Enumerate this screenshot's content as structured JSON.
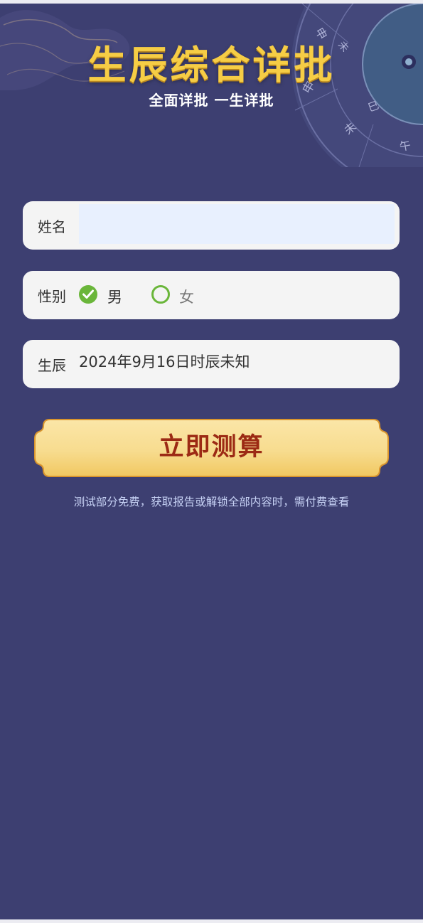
{
  "header": {
    "title": "生辰综合详批",
    "subtitle": "全面详批 一生详批"
  },
  "dial": {
    "glyphs": [
      "申",
      "未",
      "午",
      "巳",
      "未",
      "申"
    ]
  },
  "form": {
    "name": {
      "label": "姓名",
      "value": ""
    },
    "gender": {
      "label": "性别",
      "options": [
        {
          "label": "男",
          "selected": true
        },
        {
          "label": "女",
          "selected": false
        }
      ]
    },
    "birth": {
      "label": "生辰",
      "value": "2024年9月16日时辰未知"
    }
  },
  "submit_label": "立即测算",
  "note": "测试部分免费，获取报告或解锁全部内容时，需付费查看",
  "colors": {
    "background": "#3d3f71",
    "title": "#f6cd45",
    "accent_green": "#6ab63a",
    "button_gold": "#f8d98a",
    "button_text": "#9c2a14",
    "note_text": "#c7d2f5"
  }
}
